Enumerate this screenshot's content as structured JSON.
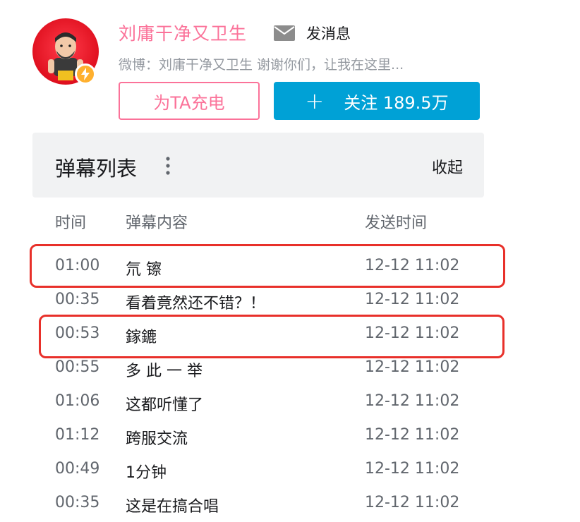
{
  "profile": {
    "username": "刘庸干净又卫生",
    "message_label": "发消息",
    "sign": "微博：刘庸干净又卫生 谢谢你们，让我在这里..."
  },
  "buttons": {
    "charge_label": "为TA充电",
    "follow_label": "关注 189.5万"
  },
  "danmaku_panel": {
    "title": "弹幕列表",
    "collapse_label": "收起",
    "columns": [
      "时间",
      "弹幕内容",
      "发送时间"
    ],
    "rows": [
      {
        "time": "01:00",
        "content": "氘 镲",
        "sent": "12-12 11:02",
        "highlighted": true
      },
      {
        "time": "00:35",
        "content": "看着竟然还不错？！",
        "sent": "12-12 11:02",
        "highlighted": false
      },
      {
        "time": "00:53",
        "content": "鎵鏕",
        "sent": "12-12 11:02",
        "highlighted": true
      },
      {
        "time": "00:55",
        "content": "多 此 一 举",
        "sent": "12-12 11:02",
        "highlighted": false
      },
      {
        "time": "01:06",
        "content": "这都听懂了",
        "sent": "12-12 11:02",
        "highlighted": false
      },
      {
        "time": "01:12",
        "content": "跨服交流",
        "sent": "12-12 11:02",
        "highlighted": false
      },
      {
        "time": "00:49",
        "content": "1分钟",
        "sent": "12-12 11:02",
        "highlighted": false
      },
      {
        "time": "00:35",
        "content": "这是在搞合唱",
        "sent": "12-12 11:02",
        "highlighted": false
      }
    ]
  },
  "colors": {
    "accent_pink": "#fb7299",
    "follow_blue": "#00a1d6",
    "highlight_red": "#e8302a",
    "badge_yellow": "#ffb02e"
  },
  "icons": [
    "avatar",
    "lightning-icon",
    "mail-icon",
    "plus-icon",
    "more-vertical-icon"
  ]
}
